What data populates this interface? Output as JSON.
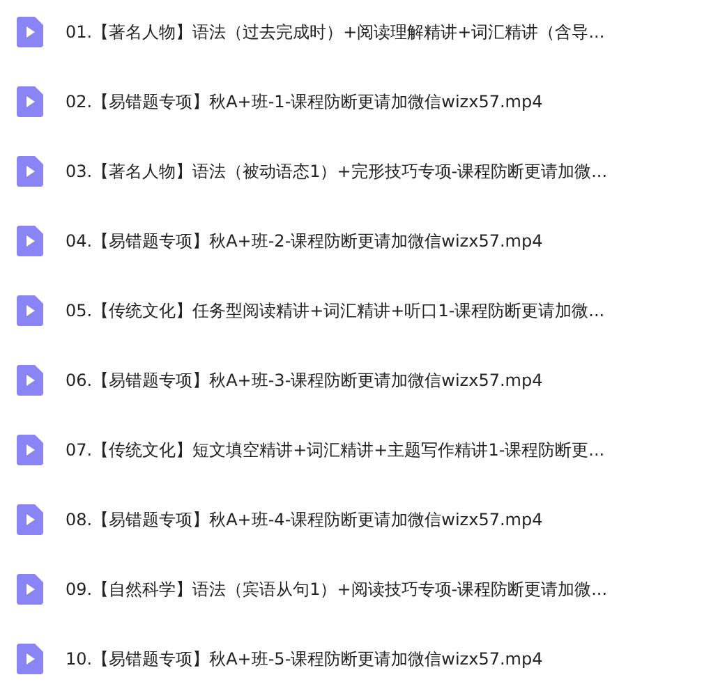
{
  "files": [
    {
      "name": "01.【著名人物】语法（过去完成时）+阅读理解精讲+词汇精讲（含导..."
    },
    {
      "name": "02.【易错题专项】秋A+班-1-课程防断更请加微信wizx57.mp4"
    },
    {
      "name": "03.【著名人物】语法（被动语态1）+完形技巧专项-课程防断更请加微..."
    },
    {
      "name": "04.【易错题专项】秋A+班-2-课程防断更请加微信wizx57.mp4"
    },
    {
      "name": "05.【传统文化】任务型阅读精讲+词汇精讲+听口1-课程防断更请加微..."
    },
    {
      "name": "06.【易错题专项】秋A+班-3-课程防断更请加微信wizx57.mp4"
    },
    {
      "name": "07.【传统文化】短文填空精讲+词汇精讲+主题写作精讲1-课程防断更..."
    },
    {
      "name": "08.【易错题专项】秋A+班-4-课程防断更请加微信wizx57.mp4"
    },
    {
      "name": "09.【自然科学】语法（宾语从句1）+阅读技巧专项-课程防断更请加微..."
    },
    {
      "name": "10.【易错题专项】秋A+班-5-课程防断更请加微信wizx57.mp4"
    }
  ]
}
